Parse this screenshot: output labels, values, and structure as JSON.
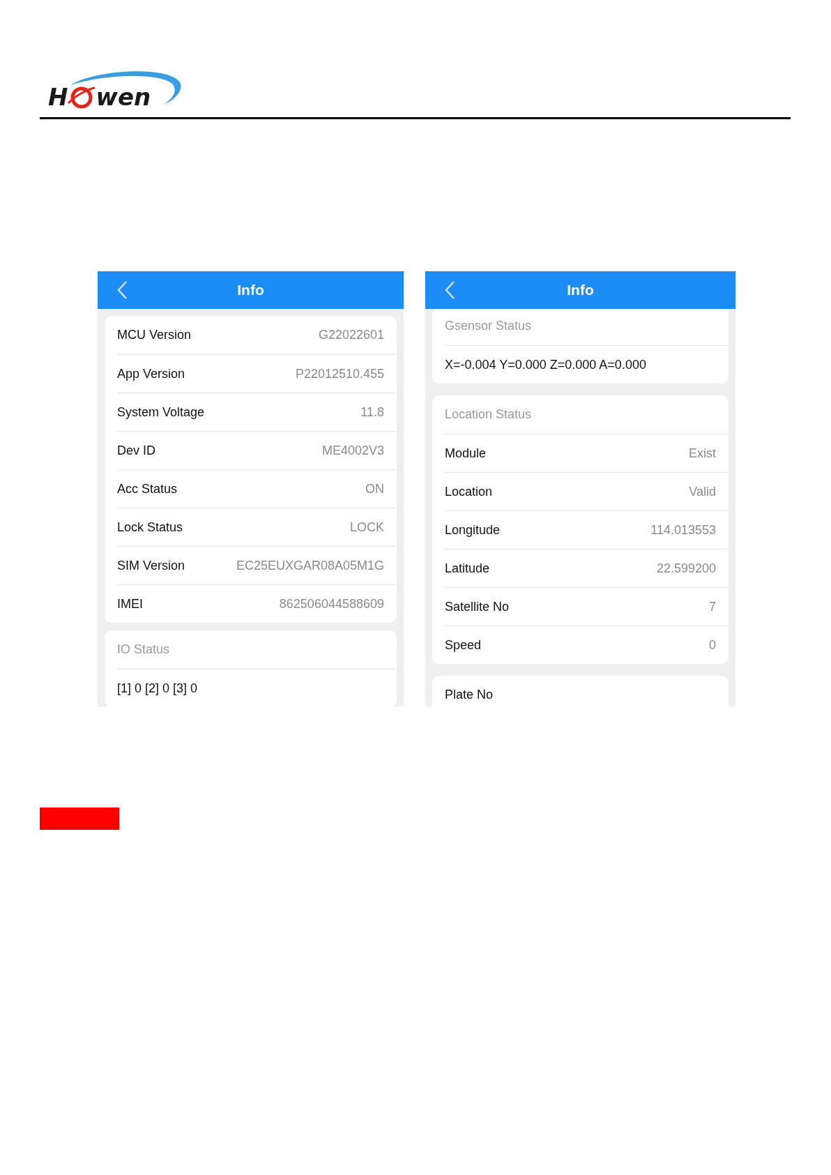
{
  "logo": {
    "letter": "H",
    "rest": "wen"
  },
  "screens": [
    {
      "title": "Info",
      "scrolled": false,
      "sections": [
        {
          "items": [
            {
              "kind": "field",
              "label": "MCU Version",
              "value": "G22022601"
            },
            {
              "kind": "field",
              "label": "App Version",
              "value": "P22012510.455"
            },
            {
              "kind": "field",
              "label": "System Voltage",
              "value": "11.8"
            },
            {
              "kind": "field",
              "label": "Dev ID",
              "value": "ME4002V3"
            },
            {
              "kind": "field",
              "label": "Acc Status",
              "value": "ON"
            },
            {
              "kind": "field",
              "label": "Lock Status",
              "value": "LOCK"
            },
            {
              "kind": "field",
              "label": "SIM Version",
              "value": "EC25EUXGAR08A05M1G"
            },
            {
              "kind": "field",
              "label": "IMEI",
              "value": "862506044588609"
            }
          ]
        },
        {
          "items": [
            {
              "kind": "heading",
              "label": "IO Status"
            },
            {
              "kind": "text",
              "label": "[1] 0 [2] 0 [3] 0"
            }
          ]
        }
      ]
    },
    {
      "title": "Info",
      "scrolled": true,
      "sections": [
        {
          "items": [
            {
              "kind": "heading",
              "label": "Gsensor Status"
            },
            {
              "kind": "text",
              "label": "X=-0.004 Y=0.000 Z=0.000 A=0.000"
            }
          ]
        },
        {
          "items": [
            {
              "kind": "heading",
              "label": "Location Status"
            },
            {
              "kind": "field",
              "label": "Module",
              "value": "Exist"
            },
            {
              "kind": "field",
              "label": "Location",
              "value": "Valid"
            },
            {
              "kind": "field",
              "label": "Longitude",
              "value": "114.013553"
            },
            {
              "kind": "field",
              "label": "Latitude",
              "value": "22.599200"
            },
            {
              "kind": "field",
              "label": "Satellite No",
              "value": "7"
            },
            {
              "kind": "field",
              "label": "Speed",
              "value": "0"
            }
          ]
        },
        {
          "items": [
            {
              "kind": "text",
              "label": "Plate No"
            }
          ]
        }
      ]
    }
  ]
}
